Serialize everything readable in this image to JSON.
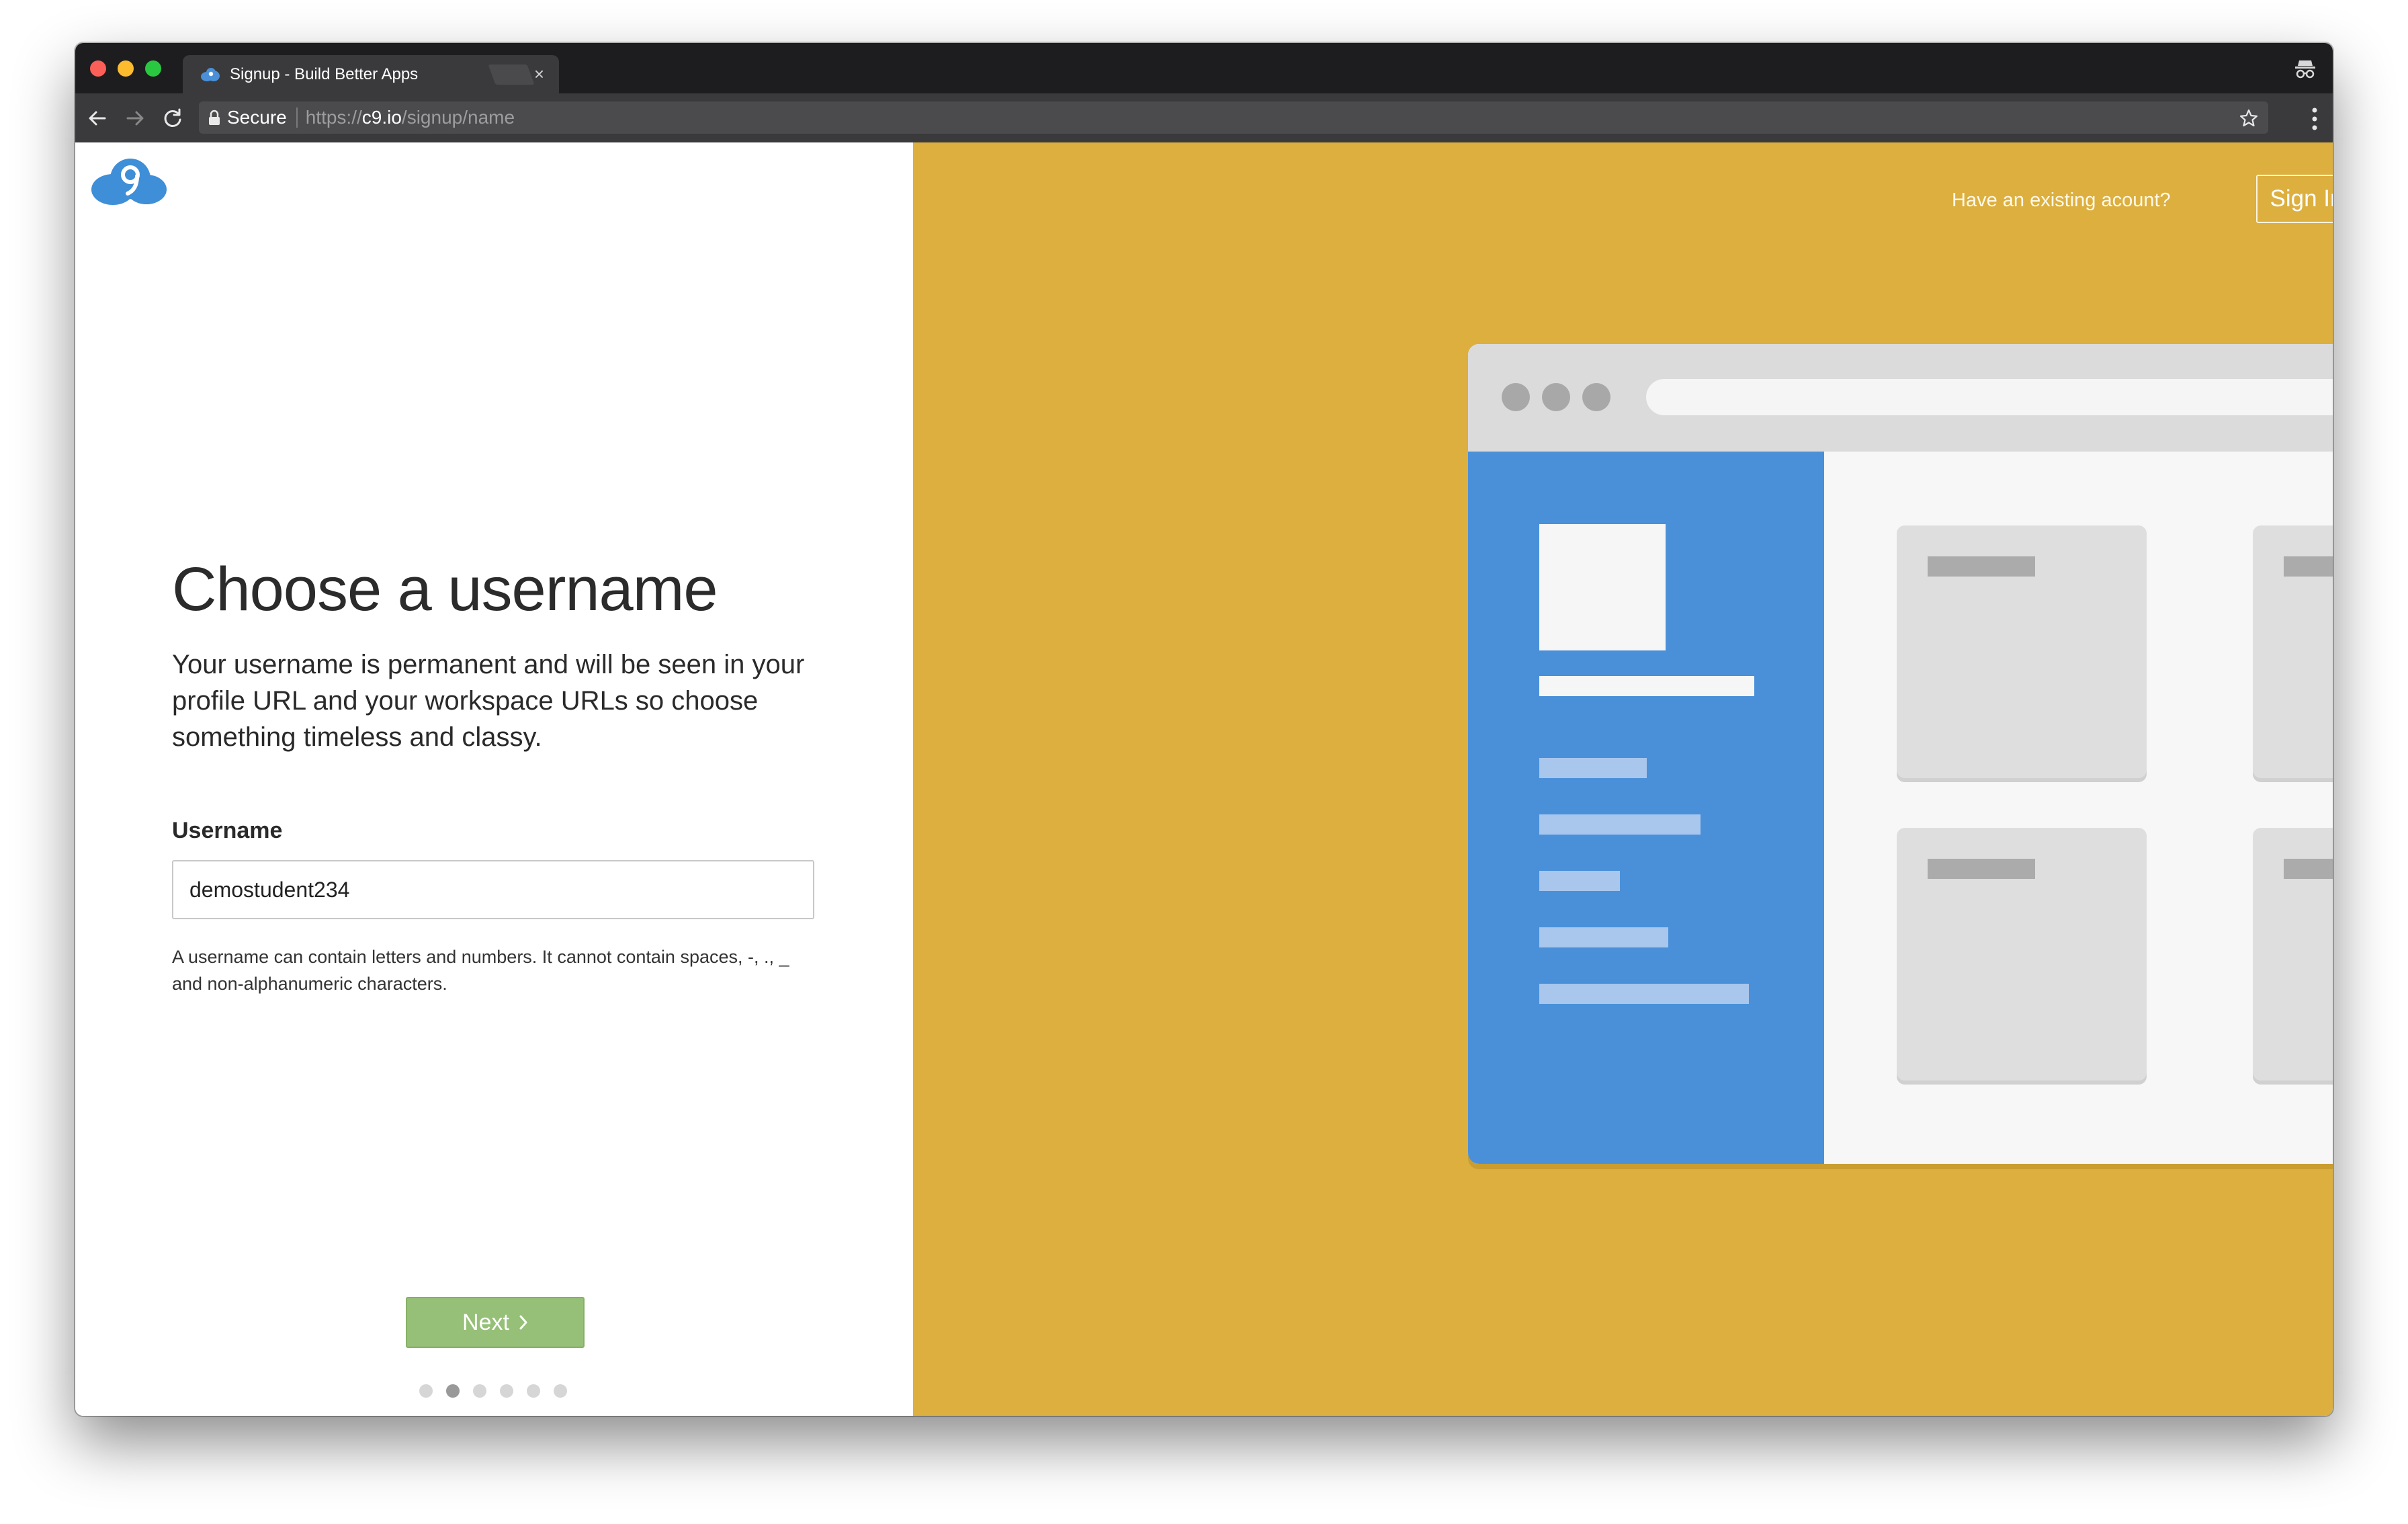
{
  "browser": {
    "tab_title": "Signup - Build Better Apps",
    "tab_close": "×",
    "secure_label": "Secure",
    "url_scheme": "https://",
    "url_host": "c9.io",
    "url_path": "/signup/name"
  },
  "page": {
    "heading": "Choose a username",
    "description": "Your username is permanent and will be seen in your profile URL and your workspace URLs so choose something timeless and classy.",
    "username_label": "Username",
    "username_value": "demostudent234",
    "hint": "A username can contain letters and numbers. It cannot contain spaces, -, ., _ and non-alphanumeric characters.",
    "next_label": "Next",
    "steps_total": 6,
    "current_step": 2
  },
  "side": {
    "existing_account_text": "Have an existing acount?",
    "signin_label": "Sign In"
  },
  "colors": {
    "accent_yellow": "#dcaf3f",
    "next_green": "#96c077",
    "illustration_blue": "#4a90d9",
    "brand_blue": "#3f8ed8"
  },
  "icons": [
    "cloud9-logo",
    "back-arrow-icon",
    "forward-arrow-icon",
    "reload-icon",
    "lock-icon",
    "star-icon",
    "menu-icon",
    "incognito-icon",
    "chevron-right-icon"
  ]
}
